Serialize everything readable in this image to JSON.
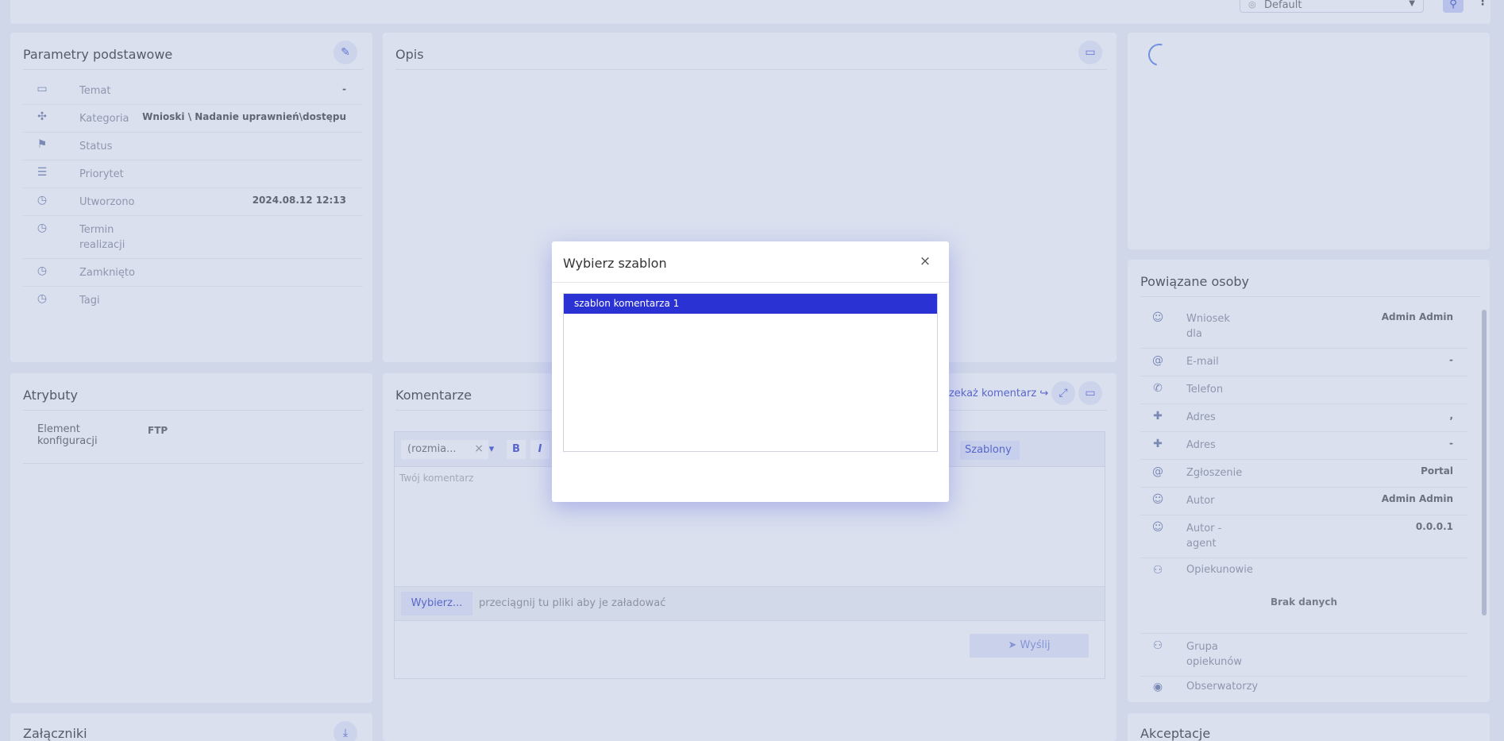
{
  "topbar": {
    "profile_value": "Default"
  },
  "params_panel": {
    "title": "Parametry podstawowe",
    "rows": [
      {
        "label": "Temat",
        "value": "-",
        "icon": "chat-icon"
      },
      {
        "label": "Kategoria",
        "value": "Wnioski \\ Nadanie uprawnień\\dostępu",
        "icon": "grid-icon"
      },
      {
        "label": "Status",
        "value": "",
        "icon": "flag-icon"
      },
      {
        "label": "Priorytet",
        "value": "",
        "icon": "priority-icon"
      },
      {
        "label": "Utworzono",
        "value": "2024.08.12 12:13",
        "icon": "alarm-icon"
      },
      {
        "label": "Termin realizacji",
        "value": "",
        "icon": "alarm-icon"
      },
      {
        "label": "Zamknięto",
        "value": "",
        "icon": "alarm-icon"
      },
      {
        "label": "Tagi",
        "value": "",
        "icon": "alarm-icon"
      }
    ]
  },
  "description_panel": {
    "title": "Opis"
  },
  "attributes_panel": {
    "title": "Atrybuty",
    "rows": [
      {
        "label": "Element konfiguracji",
        "value": "FTP"
      }
    ]
  },
  "comments_panel": {
    "title": "Komentarze",
    "forward_link": "Przekaż komentarz",
    "size_select": "(rozmia...",
    "bold": "B",
    "italic": "I",
    "templates_link": "Szablony",
    "placeholder": "Twój komentarz",
    "choose_button": "Wybierz...",
    "drop_hint": "przeciągnij tu pliki aby je załadować",
    "send_button": "Wyślij"
  },
  "attachments_panel": {
    "title": "Załączniki"
  },
  "people_panel": {
    "title": "Powiązane osoby",
    "rows": [
      {
        "label": "Wniosek dla",
        "value": "Admin Admin",
        "icon": "user-icon"
      },
      {
        "label": "E-mail",
        "value": "-",
        "icon": "at-icon"
      },
      {
        "label": "Telefon",
        "value": "",
        "icon": "phone-icon"
      },
      {
        "label": "Adres",
        "value": ",",
        "icon": "pin-icon"
      },
      {
        "label": "Adres",
        "value": "-",
        "icon": "pin-icon"
      },
      {
        "label": "Zgłoszenie",
        "value": "Portal",
        "icon": "at-icon"
      },
      {
        "label": "Autor",
        "value": "Admin Admin",
        "icon": "user-icon"
      },
      {
        "label": "Autor - agent",
        "value": "0.0.0.1",
        "icon": "user-icon"
      },
      {
        "label": "Opiekunowie",
        "value": "",
        "icon": "group-icon"
      }
    ],
    "no_data": "Brak danych",
    "group_label": "Grupa opiekunów",
    "observers_label": "Obserwatorzy"
  },
  "acceptance_panel": {
    "title": "Akceptacje"
  },
  "modal": {
    "title": "Wybierz szablon",
    "close": "×",
    "templates": [
      "szablon komentarza 1"
    ]
  }
}
